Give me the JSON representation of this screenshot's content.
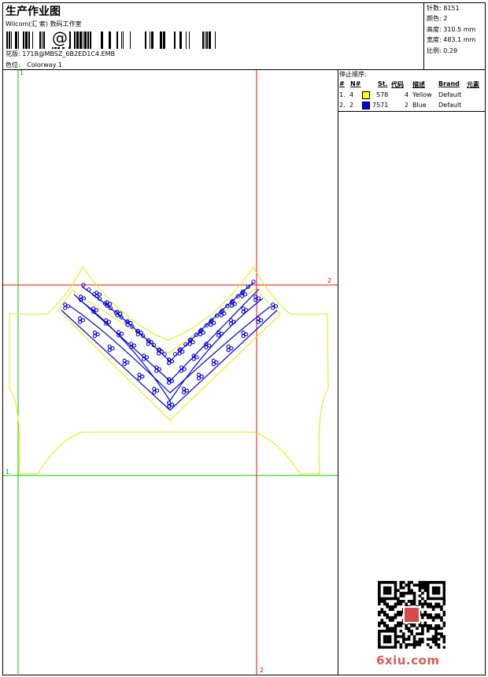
{
  "header": {
    "title": "生产作业图",
    "company": "Wilcom(汇 索) 数码工作室",
    "barcode_symbol": "@",
    "design_label": "花版:",
    "design_value": "1718@MBSZ_6B2ED1C4.EMB",
    "colorway_label": "色位:",
    "colorway_value": "Colorway 1"
  },
  "stats": [
    {
      "label": "针数:",
      "value": "8151"
    },
    {
      "label": "颜色:",
      "value": "2"
    },
    {
      "label": "高度:",
      "value": "310.5 mm"
    },
    {
      "label": "宽度:",
      "value": "483.1 mm"
    },
    {
      "label": "比例:",
      "value": "0.29"
    }
  ],
  "stop_sequence": {
    "title": "停止顺序:",
    "headers": [
      "#",
      "N#",
      "St.",
      "代码",
      "描述",
      "Brand",
      "元素"
    ],
    "rows": [
      {
        "index": "1.",
        "needle": "4",
        "color": "#ffff00",
        "stitches": "578",
        "code": "4",
        "description": "Yellow",
        "brand": "Default"
      },
      {
        "index": "2.",
        "needle": "2",
        "color": "#0000ff",
        "stitches": "7571",
        "code": "2",
        "description": "Blue",
        "brand": "Default"
      }
    ]
  },
  "guides": {
    "top_left": "1",
    "horizontal_red": "2",
    "horizontal_green": "1",
    "bottom_red": "2"
  },
  "watermark": "6xiu.com"
}
